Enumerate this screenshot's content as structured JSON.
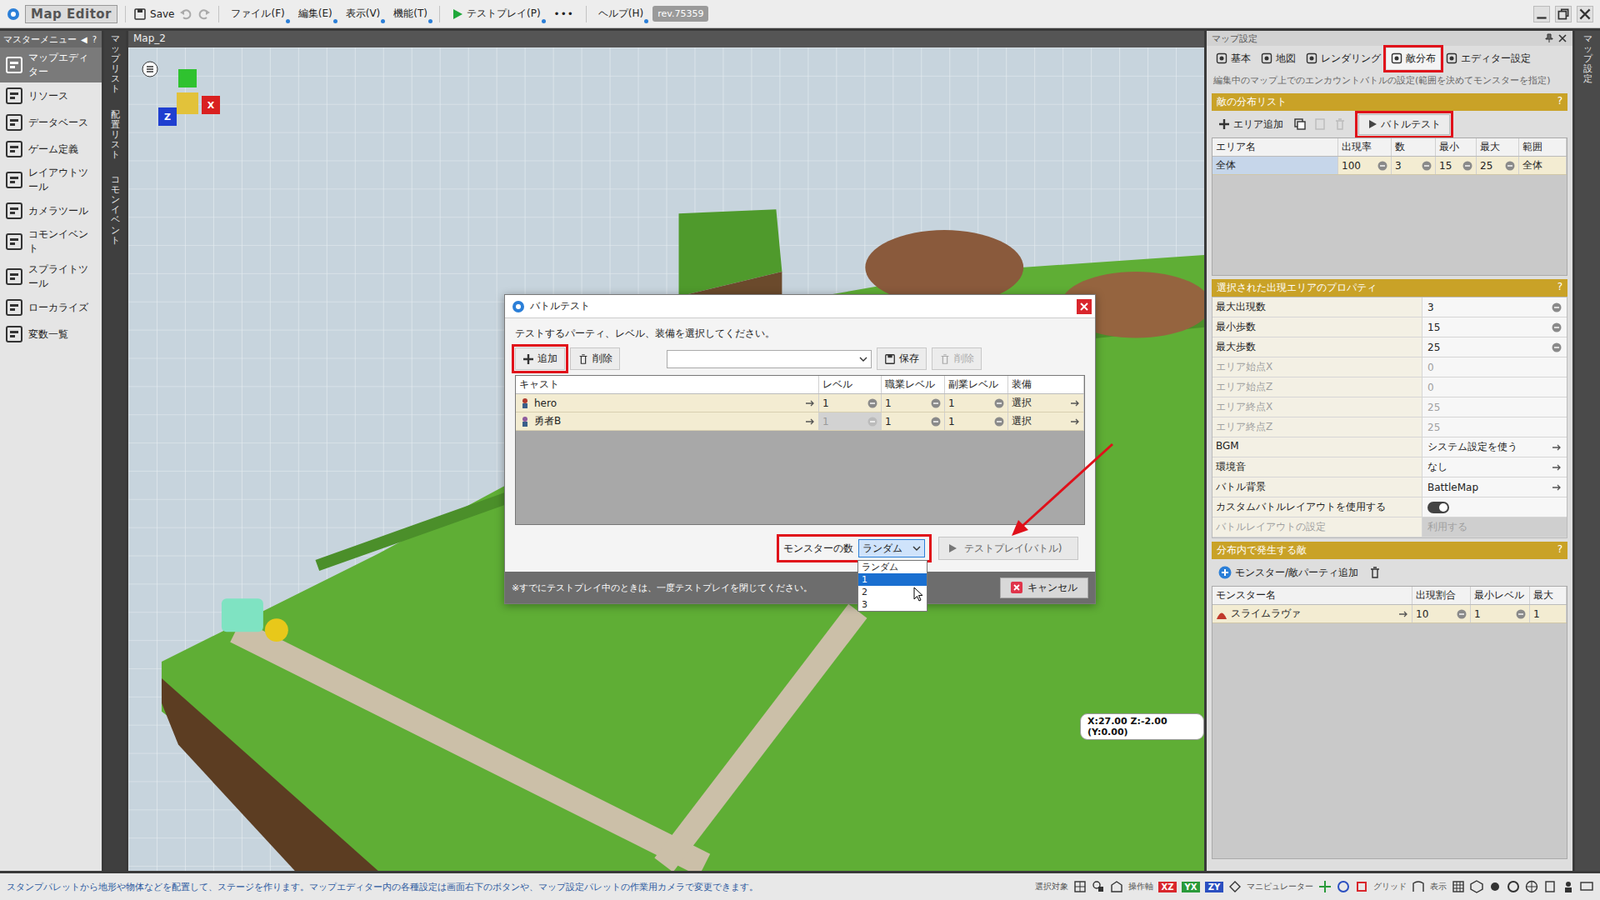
{
  "toolbar": {
    "logo": "Map Editor",
    "save": "Save",
    "menus": [
      "ファイル(F)",
      "編集(E)",
      "表示(V)",
      "機能(T)"
    ],
    "testplay": "テストプレイ(P)",
    "more": "•••",
    "help": "ヘルプ(H)",
    "revision": "rev.75359"
  },
  "sidebar": {
    "title": "マスターメニュー",
    "collapse": "◀",
    "help": "?",
    "items": [
      {
        "label": "マップエディター",
        "selected": true
      },
      {
        "label": "リソース",
        "selected": false
      },
      {
        "label": "データベース",
        "selected": false
      },
      {
        "label": "ゲーム定義",
        "selected": false
      },
      {
        "label": "レイアウトツール",
        "selected": false
      },
      {
        "label": "カメラツール",
        "selected": false
      },
      {
        "label": "コモンイベント",
        "selected": false
      },
      {
        "label": "スプライトツール",
        "selected": false
      },
      {
        "label": "ローカライズ",
        "selected": false
      },
      {
        "label": "変数一覧",
        "selected": false
      }
    ]
  },
  "side_tabs": [
    "マップリスト",
    "配置リスト",
    "コモンイベント"
  ],
  "viewport": {
    "title": "Map_2",
    "coords": "X:27.00 Z:-2.00 (Y:0.00)",
    "gizmo_x": "X",
    "gizmo_z": "Z"
  },
  "map_settings": {
    "title": "マップ設定",
    "tabs": [
      {
        "label": "基本",
        "selected": false,
        "highlighted": false
      },
      {
        "label": "地図",
        "selected": false,
        "highlighted": false
      },
      {
        "label": "レンダリング",
        "selected": false,
        "highlighted": false
      },
      {
        "label": "敵分布",
        "selected": true,
        "highlighted": true
      },
      {
        "label": "エディター設定",
        "selected": false,
        "highlighted": false
      }
    ],
    "description": "編集中のマップ上でのエンカウントバトルの設定(範囲を決めてモンスターを指定)",
    "distribution": {
      "title": "敵の分布リスト",
      "help": "?",
      "add": "エリア追加",
      "battle_test": {
        "label": "バトルテスト",
        "highlighted": true
      },
      "columns": [
        "エリア名",
        "出現率",
        "数",
        "最小",
        "最大",
        "範囲"
      ],
      "rows": [
        {
          "name": "全体",
          "rate": "100",
          "count": "3",
          "min": "15",
          "max": "25",
          "range": "全体",
          "selected": true
        }
      ]
    },
    "properties": {
      "title": "選択された出現エリアのプロパティ",
      "help": "?",
      "rows": [
        {
          "label": "最大出現数",
          "value": "3",
          "kind": "number",
          "disabled": false
        },
        {
          "label": "最小歩数",
          "value": "15",
          "kind": "number",
          "disabled": false
        },
        {
          "label": "最大歩数",
          "value": "25",
          "kind": "number",
          "disabled": false
        },
        {
          "label": "エリア始点X",
          "value": "0",
          "kind": "number",
          "disabled": true
        },
        {
          "label": "エリア始点Z",
          "value": "0",
          "kind": "number",
          "disabled": true
        },
        {
          "label": "エリア終点X",
          "value": "25",
          "kind": "number",
          "disabled": true
        },
        {
          "label": "エリア終点Z",
          "value": "25",
          "kind": "number",
          "disabled": true
        },
        {
          "label": "BGM",
          "value": "システム設定を使う",
          "kind": "link",
          "disabled": false
        },
        {
          "label": "環境音",
          "value": "なし",
          "kind": "link",
          "disabled": false
        },
        {
          "label": "バトル背景",
          "value": "BattleMap",
          "kind": "link",
          "disabled": false
        },
        {
          "label": "カスタムバトルレイアウトを使用する",
          "kind": "toggle",
          "on": true,
          "disabled": false
        },
        {
          "label": "バトルレイアウトの設定",
          "value": "利用する",
          "kind": "text",
          "disabled": true
        }
      ]
    },
    "enemies": {
      "title": "分布内で発生する敵",
      "help": "?",
      "add": "モンスター/敵パーティ追加",
      "columns": [
        "モンスター名",
        "出現割合",
        "最小レベル",
        "最大"
      ],
      "rows": [
        {
          "name": "スライムラヴァ",
          "rate": "10",
          "min": "1",
          "max": "1"
        }
      ]
    }
  },
  "right_strip": "マップ設定",
  "dialog": {
    "title": "バトルテスト",
    "instruction": "テストするパーティ、レベル、装備を選択してください。",
    "add": {
      "label": "追加",
      "highlighted": true
    },
    "delete": "削除",
    "save": "保存",
    "delete2": {
      "label": "削除",
      "disabled": true
    },
    "columns": [
      "キャスト",
      "レベル",
      "職業レベル",
      "副業レベル",
      "装備"
    ],
    "rows": [
      {
        "cast": "hero",
        "level": "1",
        "level_disabled": false,
        "job": "1",
        "sub": "1",
        "equip": "選択"
      },
      {
        "cast": "勇者B",
        "level": "1",
        "level_disabled": true,
        "job": "1",
        "sub": "1",
        "equip": "選択"
      }
    ],
    "monster_count": {
      "label": "モンスターの数",
      "value": "ランダム",
      "highlighted": true,
      "expanded": true,
      "options": [
        {
          "label": "ランダム",
          "selected": false
        },
        {
          "label": "1",
          "selected": true
        },
        {
          "label": "2",
          "selected": false
        },
        {
          "label": "3",
          "selected": false
        }
      ]
    },
    "test_button": "テストプレイ(バトル)",
    "note": "※すでにテストプレイ中のときは、一度テストプレイを閉じてください。",
    "cancel": "キャンセル"
  },
  "annotations": {
    "arrow": true
  },
  "status_bar": {
    "message": "スタンプパレットから地形や物体などを配置して、ステージを作ります。マップエディター内の各種設定は画面右下のボタンや、マップ設定パレットの作業用カメラで変更できます。",
    "target": "選択対象",
    "axis": "操作軸",
    "axes": [
      {
        "label": "XZ",
        "color": "#d9262c"
      },
      {
        "label": "YX",
        "color": "#2a9a3a"
      },
      {
        "label": "ZY",
        "color": "#2b4fc0"
      }
    ],
    "manipulator": "マニピュレーター",
    "grid": "グリッド",
    "display": "表示"
  }
}
